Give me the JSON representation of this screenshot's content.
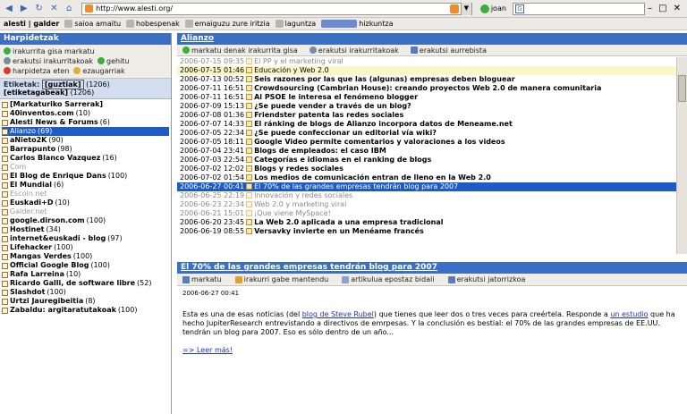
{
  "browser": {
    "url": "http://www.alesti.org/",
    "go_label": "joan",
    "search_value": ""
  },
  "bookmarks": {
    "title": "alesti | galder",
    "items": [
      "saioa amaitu",
      "hobespenak",
      "emaiguzu zure iritzia",
      "laguntza",
      "hizkuntza"
    ]
  },
  "left": {
    "title": "Harpidetzak",
    "actions": [
      "irakurrita gisa markatu",
      "erakutsi irakurritakoak",
      "gehitu",
      "harpidetza eten",
      "ezaugarriak"
    ],
    "tags_label": "Etiketak:",
    "tags": [
      "[guztiak]",
      "(1206)",
      "[etiketagabeak]",
      "(1206)"
    ],
    "feeds": [
      {
        "name": "[Markaturiko Sarrerak]",
        "count": "",
        "style": "bold"
      },
      {
        "name": "40inventos.com",
        "count": "(10)",
        "style": "bold"
      },
      {
        "name": "Alesti News & Forums",
        "count": "(6)",
        "style": "bold"
      },
      {
        "name": "Alianzo",
        "count": "(69)",
        "style": "sel"
      },
      {
        "name": "aNieto2K",
        "count": "(90)",
        "style": "bold"
      },
      {
        "name": "Barrapunto",
        "count": "(98)",
        "style": "bold"
      },
      {
        "name": "Carlos Blanco Vazquez",
        "count": "(16)",
        "style": "bold"
      },
      {
        "name": "Com",
        "count": "",
        "style": "grey"
      },
      {
        "name": "El Blog de Enrique Dans",
        "count": "(100)",
        "style": "bold"
      },
      {
        "name": "El Mundial",
        "count": "(6)",
        "style": "bold"
      },
      {
        "name": "Escoin.net",
        "count": "",
        "style": "grey"
      },
      {
        "name": "Euskadi+D",
        "count": "(10)",
        "style": "bold"
      },
      {
        "name": "Galder.net",
        "count": "",
        "style": "grey"
      },
      {
        "name": "google.dirson.com",
        "count": "(100)",
        "style": "bold"
      },
      {
        "name": "Hostinet",
        "count": "(34)",
        "style": "bold"
      },
      {
        "name": "internet&euskadi - blog",
        "count": "(97)",
        "style": "bold"
      },
      {
        "name": "Lifehacker",
        "count": "(100)",
        "style": "bold"
      },
      {
        "name": "Mangas Verdes",
        "count": "(100)",
        "style": "bold"
      },
      {
        "name": "Official Google Blog",
        "count": "(100)",
        "style": "bold"
      },
      {
        "name": "Rafa Larreina",
        "count": "(10)",
        "style": "bold"
      },
      {
        "name": "Ricardo Galli, de software libre",
        "count": "(52)",
        "style": "bold"
      },
      {
        "name": "Slashdot",
        "count": "(100)",
        "style": "bold"
      },
      {
        "name": "Urtzi Jauregibeitia",
        "count": "(8)",
        "style": "bold"
      },
      {
        "name": "Zabaldu: argitaratutakoak",
        "count": "(100)",
        "style": "bold"
      }
    ]
  },
  "right": {
    "title": "Alianzo",
    "actions": [
      "markatu denak irakurrita gisa",
      "erakutsi irakurritakoak",
      "erakutsi aurrebista"
    ],
    "articles": [
      {
        "date": "2006-07-15 09:35",
        "title": "El PP y el marketing viral",
        "style": "grey"
      },
      {
        "date": "2006-07-15 01:46",
        "title": "Educación y Web 2.0",
        "style": "hl"
      },
      {
        "date": "2006-07-13 00:52",
        "title": "Seis razones por las que las (algunas) empresas deben bloguear",
        "style": "bold"
      },
      {
        "date": "2006-07-11 16:51",
        "title": "Crowdsourcing (Cambrian House): creando proyectos Web 2.0 de manera comunitaria",
        "style": "bold"
      },
      {
        "date": "2006-07-11 16:51",
        "title": "Al PSOE le interesa el fenómeno blogger",
        "style": "bold"
      },
      {
        "date": "2006-07-09 15:13",
        "title": "¿Se puede vender a través de un blog?",
        "style": "bold"
      },
      {
        "date": "2006-07-08 01:36",
        "title": "Friendster patenta las redes sociales",
        "style": "bold"
      },
      {
        "date": "2006-07-07 14:33",
        "title": "El ránking de blogs de Alianzo incorpora datos de Meneame.net",
        "style": "bold"
      },
      {
        "date": "2006-07-05 22:34",
        "title": "¿Se puede confeccionar un editorial vía wiki?",
        "style": "bold"
      },
      {
        "date": "2006-07-05 18:11",
        "title": "Google Video permite comentarios y valoraciones a los videos",
        "style": "bold"
      },
      {
        "date": "2006-07-04 23:41",
        "title": "Blogs de empleados: el caso IBM",
        "style": "bold"
      },
      {
        "date": "2006-07-03 22:54",
        "title": "Categorías e idiomas en el ranking de blogs",
        "style": "bold"
      },
      {
        "date": "2006-07-02 12:02",
        "title": "Blogs y redes sociales",
        "style": "bold"
      },
      {
        "date": "2006-07-02 01:54",
        "title": "Los medios de comunicación entran de lleno en la Web 2.0",
        "style": "bold"
      },
      {
        "date": "2006-06-27 00:41",
        "title": "El 70% de las grandes empresas tendrán blog para 2007",
        "style": "sel"
      },
      {
        "date": "2006-06-25 22:19",
        "title": "Innovación y redes sociales",
        "style": "grey"
      },
      {
        "date": "2006-06-23 22:34",
        "title": "Web 2.0 y marketing viral",
        "style": "grey"
      },
      {
        "date": "2006-06-21 15:01",
        "title": "¡Que viene MySpace!",
        "style": "grey"
      },
      {
        "date": "2006-06-20 23:45",
        "title": "La Web 2.0 aplicada a una empresa tradicional",
        "style": "bold"
      },
      {
        "date": "2006-06-19 08:55",
        "title": "Versavky invierte en un Menéame francés",
        "style": "bold"
      }
    ],
    "detail": {
      "title": "El 70% de las grandes empresas tendrán blog para 2007",
      "actions": [
        "markatu",
        "irakurri gabe mantendu",
        "artikulua epostaz bidali",
        "erakutsi jatorrizkoa"
      ],
      "date": "2006-06-27 00:41",
      "text_1": "Esta es una de esas noticias (del ",
      "link_1": "blog de Steve Rubel",
      "text_2": ") que tienes que leer dos o tres veces para creértela. Responde a ",
      "link_2": "un estudio",
      "text_3": " que ha hecho JupiterResearch entrevistando a directivos de emrpesas. Y la conclusión es bestial: el 70% de las grandes empresas de EE.UU. tendrán un blog para 2007. Eso es sólo dentro de un año...",
      "more": "=> Leer más!"
    }
  }
}
